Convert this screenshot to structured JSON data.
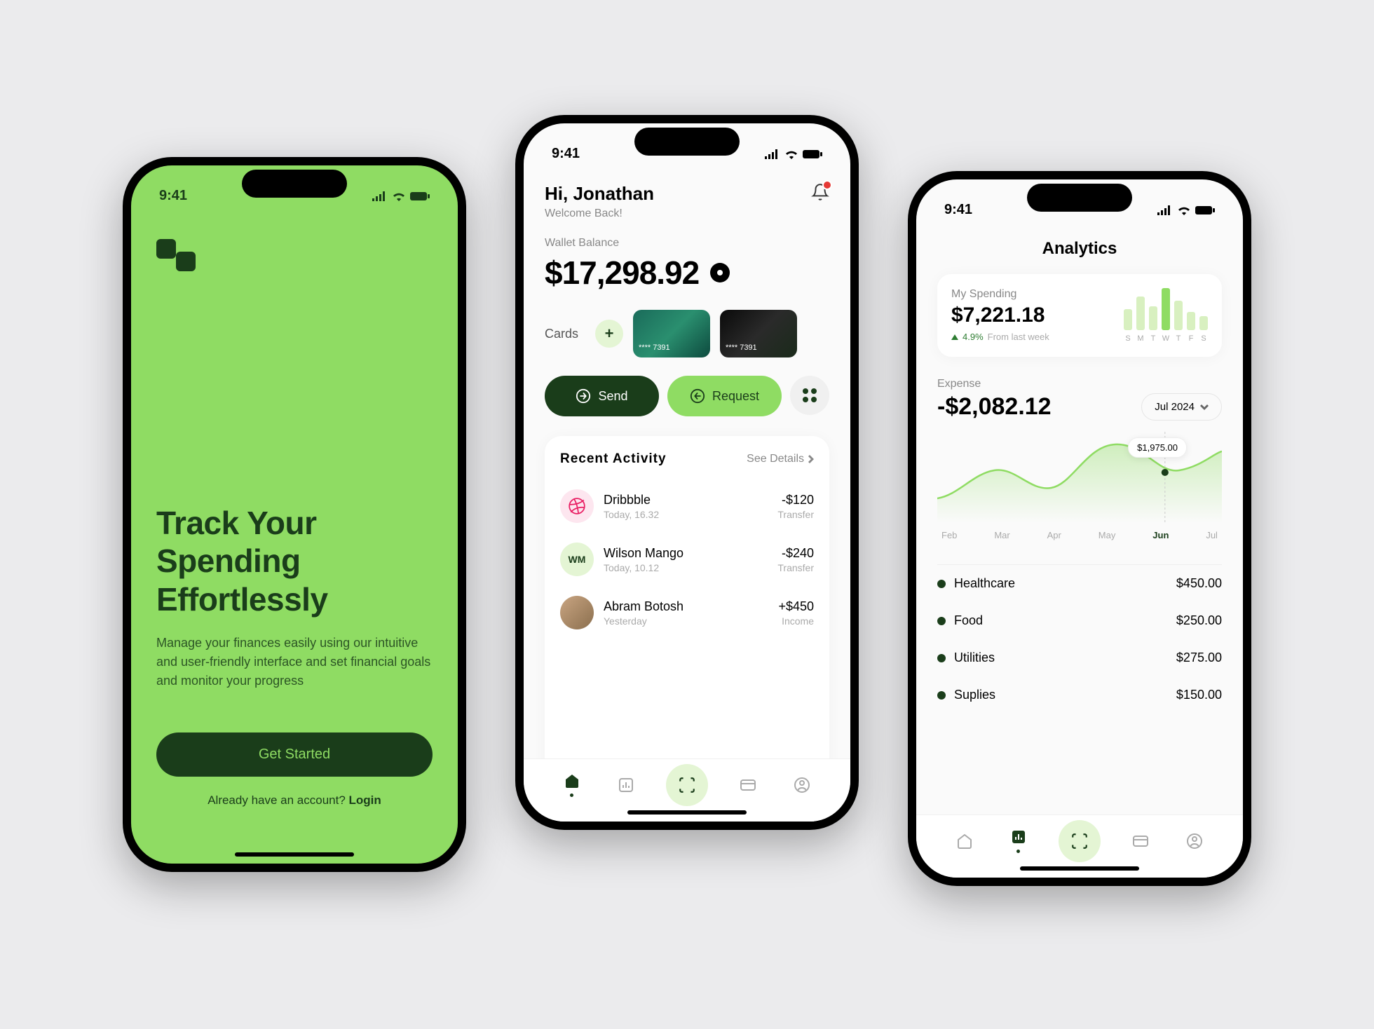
{
  "status": {
    "time": "9:41"
  },
  "onboarding": {
    "title": "Track Your Spending Effortlessly",
    "subtitle": "Manage your finances easily using our intuitive and user-friendly interface and set financial goals and monitor your progress",
    "cta": "Get Started",
    "login_prompt": "Already have an account? ",
    "login_link": "Login"
  },
  "home": {
    "greeting": "Hi, Jonathan",
    "welcome": "Welcome Back!",
    "balance_label": "Wallet Balance",
    "balance": "$17,298.92",
    "cards_label": "Cards",
    "card1_last4": "**** 7391",
    "card2_last4": "**** 7391",
    "send_label": "Send",
    "request_label": "Request",
    "activity_title": "Recent  Activity",
    "see_details": "See Details",
    "activity": [
      {
        "icon": "dribbble",
        "name": "Dribbble",
        "time": "Today, 16.32",
        "amount": "-$120",
        "type": "Transfer"
      },
      {
        "icon": "WM",
        "name": "Wilson Mango",
        "time": "Today, 10.12",
        "amount": "-$240",
        "type": "Transfer"
      },
      {
        "icon": "photo",
        "name": "Abram Botosh",
        "time": "Yesterday",
        "amount": "+$450",
        "type": "Income"
      }
    ]
  },
  "analytics": {
    "title": "Analytics",
    "spending_label": "My Spending",
    "spending_value": "$7,221.18",
    "spending_delta": "4.9%",
    "spending_delta_label": "From last week",
    "days": [
      "S",
      "M",
      "T",
      "W",
      "T",
      "F",
      "S"
    ],
    "expense_label": "Expense",
    "expense_value": "-$2,082.12",
    "month_selector": "Jul 2024",
    "tooltip": "$1,975.00",
    "months": [
      "Feb",
      "Mar",
      "Apr",
      "May",
      "Jun",
      "Jul"
    ],
    "active_month": "Jun",
    "categories": [
      {
        "name": "Healthcare",
        "amount": "$450.00"
      },
      {
        "name": "Food",
        "amount": "$250.00"
      },
      {
        "name": "Utilities",
        "amount": "$275.00"
      },
      {
        "name": "Suplies",
        "amount": "$150.00"
      }
    ]
  },
  "chart_data": [
    {
      "type": "bar",
      "title": "My Spending (weekly)",
      "categories": [
        "S",
        "M",
        "T",
        "W",
        "T",
        "F",
        "S"
      ],
      "values": [
        30,
        48,
        34,
        60,
        42,
        26,
        20
      ],
      "highlight_index": 3
    },
    {
      "type": "area",
      "title": "Expense trend",
      "x": [
        "Feb",
        "Mar",
        "Apr",
        "May",
        "Jun",
        "Jul"
      ],
      "values": [
        850,
        1250,
        1020,
        1975,
        1550,
        1780
      ],
      "tooltip_point": {
        "x": "May",
        "value": 1975.0
      },
      "ylim": [
        0,
        2200
      ]
    }
  ]
}
